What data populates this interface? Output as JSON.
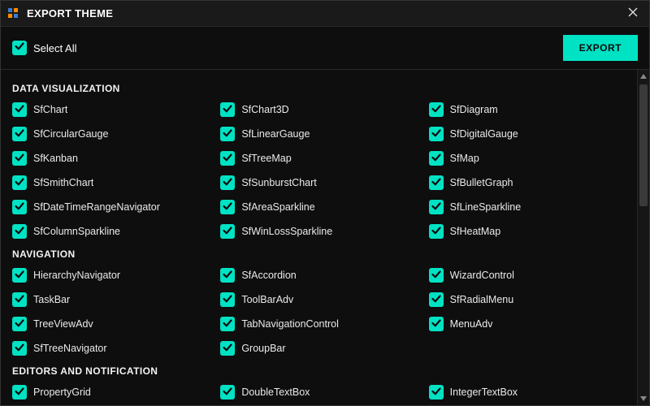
{
  "window": {
    "title": "EXPORT THEME"
  },
  "toolbar": {
    "select_all_label": "Select All",
    "export_button_label": "EXPORT"
  },
  "accent_color": "#00e2c4",
  "sections": [
    {
      "header": "DATA VISUALIZATION",
      "items": [
        {
          "label": "SfChart",
          "checked": true
        },
        {
          "label": "SfChart3D",
          "checked": true
        },
        {
          "label": "SfDiagram",
          "checked": true
        },
        {
          "label": "SfCircularGauge",
          "checked": true
        },
        {
          "label": "SfLinearGauge",
          "checked": true
        },
        {
          "label": "SfDigitalGauge",
          "checked": true
        },
        {
          "label": "SfKanban",
          "checked": true
        },
        {
          "label": "SfTreeMap",
          "checked": true
        },
        {
          "label": "SfMap",
          "checked": true
        },
        {
          "label": "SfSmithChart",
          "checked": true
        },
        {
          "label": "SfSunburstChart",
          "checked": true
        },
        {
          "label": "SfBulletGraph",
          "checked": true
        },
        {
          "label": "SfDateTimeRangeNavigator",
          "checked": true
        },
        {
          "label": "SfAreaSparkline",
          "checked": true
        },
        {
          "label": "SfLineSparkline",
          "checked": true
        },
        {
          "label": "SfColumnSparkline",
          "checked": true
        },
        {
          "label": "SfWinLossSparkline",
          "checked": true
        },
        {
          "label": "SfHeatMap",
          "checked": true
        }
      ]
    },
    {
      "header": "NAVIGATION",
      "items": [
        {
          "label": "HierarchyNavigator",
          "checked": true
        },
        {
          "label": "SfAccordion",
          "checked": true
        },
        {
          "label": "WizardControl",
          "checked": true
        },
        {
          "label": "TaskBar",
          "checked": true
        },
        {
          "label": "ToolBarAdv",
          "checked": true
        },
        {
          "label": "SfRadialMenu",
          "checked": true
        },
        {
          "label": "TreeViewAdv",
          "checked": true
        },
        {
          "label": "TabNavigationControl",
          "checked": true
        },
        {
          "label": "MenuAdv",
          "checked": true
        },
        {
          "label": "SfTreeNavigator",
          "checked": true
        },
        {
          "label": "GroupBar",
          "checked": true
        }
      ]
    },
    {
      "header": "EDITORS AND NOTIFICATION",
      "items": [
        {
          "label": "PropertyGrid",
          "checked": true
        },
        {
          "label": "DoubleTextBox",
          "checked": true
        },
        {
          "label": "IntegerTextBox",
          "checked": true
        }
      ]
    }
  ]
}
